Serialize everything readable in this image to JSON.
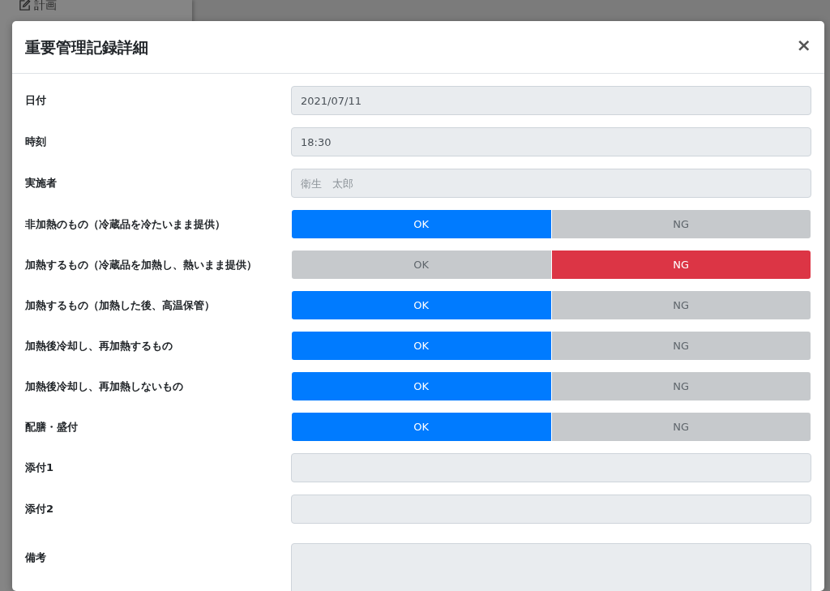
{
  "background": {
    "sidebar_item": "計画"
  },
  "modal": {
    "title": "重要管理記録詳細",
    "close": "×",
    "fields": [
      {
        "kind": "text",
        "label": "日付",
        "value": "2021/07/11"
      },
      {
        "kind": "text",
        "label": "時刻",
        "value": "18:30"
      },
      {
        "kind": "text",
        "label": "実施者",
        "placeholder": "衛生　太郎"
      },
      {
        "kind": "toggle",
        "label": "非加熱のもの（冷蔵品を冷たいまま提供）",
        "options": [
          {
            "label": "OK",
            "selected": true
          },
          {
            "label": "NG",
            "selected": false
          }
        ]
      },
      {
        "kind": "toggle",
        "label": "加熱するもの（冷蔵品を加熱し、熱いまま提供）",
        "options": [
          {
            "label": "OK",
            "selected": false
          },
          {
            "label": "NG",
            "selected": true
          }
        ]
      },
      {
        "kind": "toggle",
        "label": "加熱するもの（加熱した後、高温保管）",
        "options": [
          {
            "label": "OK",
            "selected": true
          },
          {
            "label": "NG",
            "selected": false
          }
        ]
      },
      {
        "kind": "toggle",
        "label": "加熱後冷却し、再加熱するもの",
        "options": [
          {
            "label": "OK",
            "selected": true
          },
          {
            "label": "NG",
            "selected": false
          }
        ]
      },
      {
        "kind": "toggle",
        "label": "加熱後冷却し、再加熱しないもの",
        "options": [
          {
            "label": "OK",
            "selected": true
          },
          {
            "label": "NG",
            "selected": false
          }
        ]
      },
      {
        "kind": "toggle",
        "label": "配膳・盛付",
        "options": [
          {
            "label": "OK",
            "selected": true
          },
          {
            "label": "NG",
            "selected": false
          }
        ]
      },
      {
        "kind": "text",
        "label": "添付1"
      },
      {
        "kind": "text",
        "label": "添付2"
      },
      {
        "kind": "textarea",
        "label": "備考"
      }
    ]
  }
}
